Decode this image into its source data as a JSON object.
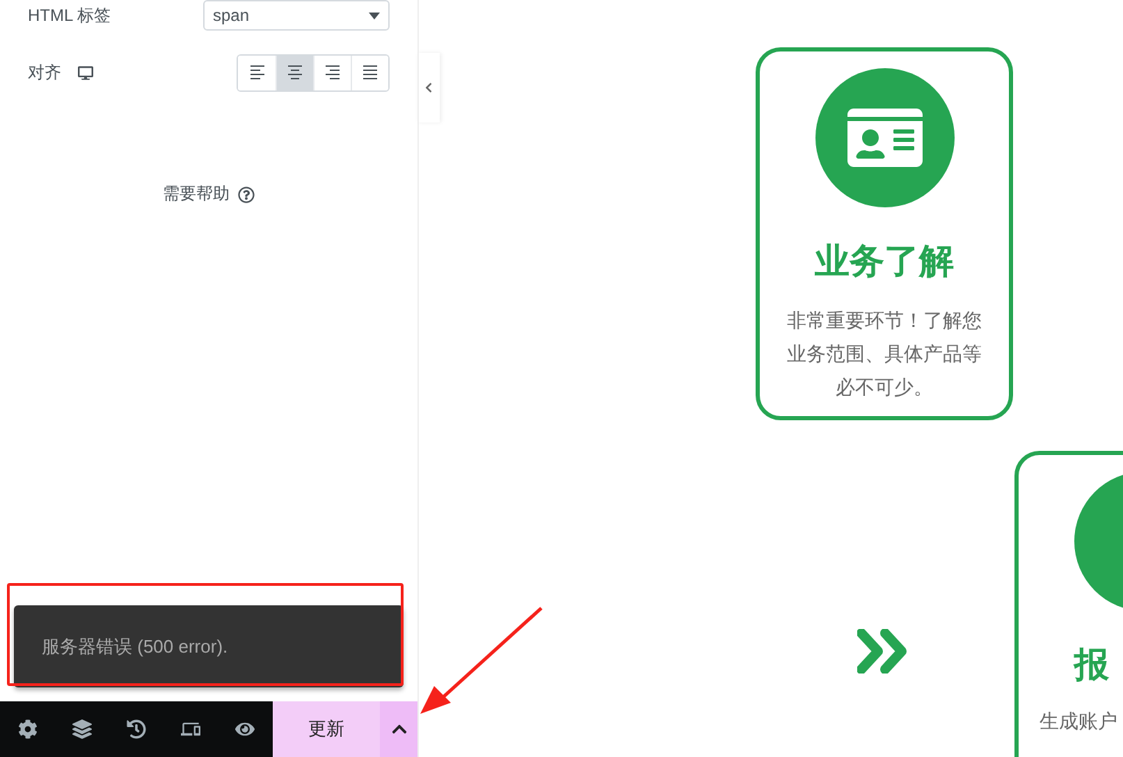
{
  "panel": {
    "fields": [
      {
        "kind": "select",
        "label": "HTML 标签",
        "value": "span"
      },
      {
        "kind": "align",
        "label": "对齐",
        "options": [
          {
            "selected": false
          },
          {
            "selected": true
          },
          {
            "selected": false
          },
          {
            "selected": false
          }
        ]
      }
    ],
    "help": "需要帮助",
    "toast": "服务器错误 (500 error).",
    "footer": {
      "update": "更新"
    }
  },
  "preview": {
    "cards": [
      {
        "title": "业务了解",
        "description": "非常重要环节！了解您业务范围、具体产品等必不可少。"
      },
      {
        "title": "报",
        "description": "生成账户"
      }
    ]
  }
}
